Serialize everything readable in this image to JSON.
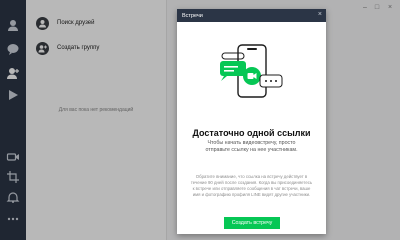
{
  "sidebar": {
    "icons": [
      "person-icon",
      "chat-bubble-icon",
      "add-friend-icon",
      "timeline-icon",
      "video-call-icon",
      "crop-icon",
      "bell-icon",
      "settings-icon"
    ]
  },
  "friends_panel": {
    "items": [
      {
        "label": "Поиск друзей",
        "icon": "person-search-icon"
      },
      {
        "label": "Создать группу",
        "icon": "group-add-icon"
      }
    ],
    "empty_text": "Для вас пока нет рекомендаций"
  },
  "modal": {
    "title": "Встречи",
    "heading": "Достаточно одной ссылки",
    "subtitle": "Чтобы начать видеовстречу, просто отправьте ссылку на нее участникам.",
    "note": "Обратите внимание, что ссылка на встречу действует в течение 90 дней после создания. Когда вы присоединяетесь к встрече или отправляете сообщения в чат встречи, ваше имя и фотографию профиля LINE видят другие участники.",
    "button_label": "Создать встречу"
  },
  "colors": {
    "rail": "#2b3546",
    "accent": "#06c755",
    "overlay": "rgba(0,0,0,0.28)"
  }
}
